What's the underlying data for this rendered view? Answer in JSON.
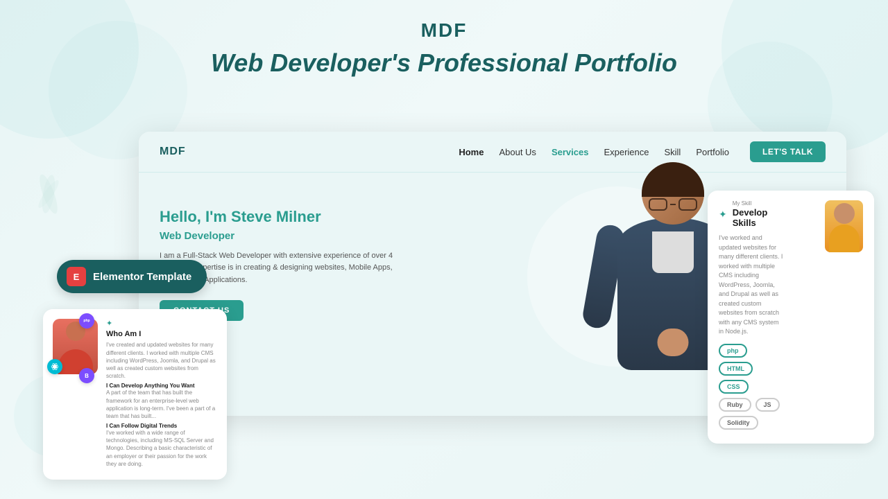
{
  "page": {
    "background": "#e8f5f5"
  },
  "header": {
    "brand": "MDF",
    "title": "Web Developer's Professional Portfolio"
  },
  "elementor_badge": {
    "label": "Elementor Template",
    "icon": "E"
  },
  "mockup": {
    "nav": {
      "brand": "MDF",
      "links": [
        {
          "label": "Home",
          "active": true
        },
        {
          "label": "About Us",
          "active": false
        },
        {
          "label": "Services",
          "active": false,
          "teal": true
        },
        {
          "label": "Experience",
          "active": false
        },
        {
          "label": "Skill",
          "active": false
        },
        {
          "label": "Portfolio",
          "active": false
        }
      ],
      "cta": "LET'S TALK"
    },
    "hero": {
      "greeting_pre": "Hello, I'm ",
      "name": "Steve Milner",
      "role": "Web Developer",
      "description": "I am a Full-Stack Web Developer with extensive experience of over 4 years. My expertise is in creating & designing websites, Mobile Apps, and Desktop Applications.",
      "contact_btn": "CONTACT US"
    }
  },
  "skills_card": {
    "title_pre": "My Skill",
    "title": "Develop Skills",
    "description": "I've worked and updated websites for many different clients. I worked with multiple CMS including WordPress, Joomla, and Drupal as well as created custom websites from scratch with any CMS system in Node.js.",
    "tags": [
      "php",
      "HTML",
      "CSS",
      "Ruby",
      "JS",
      "Solidity"
    ]
  },
  "about_card": {
    "title": "Who Am I",
    "text1": "I've created and updated websites for many different clients. I worked with multiple CMS including WordPress, Joomla, and Drupal as well as created custom websites from scratch.",
    "section1": "I Can Develop Anything You Want",
    "text2": "A part of the team that has built the framework for an enterprise-level web application is long-term. I've been a part of a team that has built...",
    "section2": "I Can Follow Digital Trends",
    "text3": "I've worked with a wide range of technologies, including MS-SQL Server and Mongo. Describing a basic characteristic of an employer or their passion for the work they are doing."
  }
}
